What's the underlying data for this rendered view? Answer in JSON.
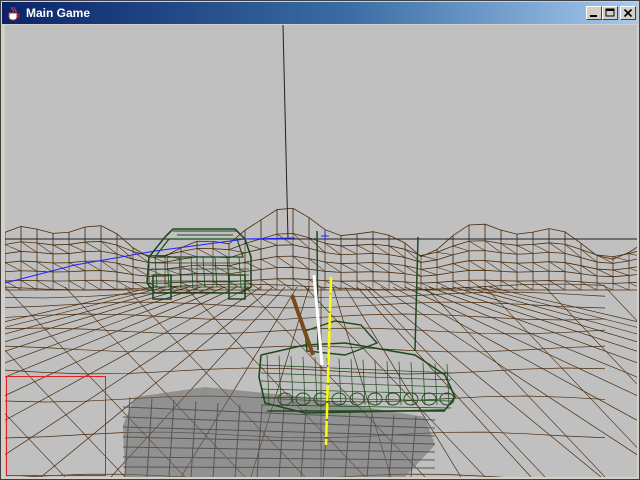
{
  "window": {
    "title": "Main Game",
    "icon": "java-coffee-cup-icon",
    "controls": [
      "minimize-icon",
      "maximize-icon",
      "close-icon"
    ]
  },
  "scene": {
    "sky_color": "#c0c0c0",
    "terrain_wire_color": "#4a2a0a",
    "vehicle_wire_color": "#1e4a1e",
    "shadow_color": "#555555",
    "marker_color": "#ffff00",
    "crosshair_color": "#2020ff",
    "minimap_border_color": "#e02020"
  }
}
